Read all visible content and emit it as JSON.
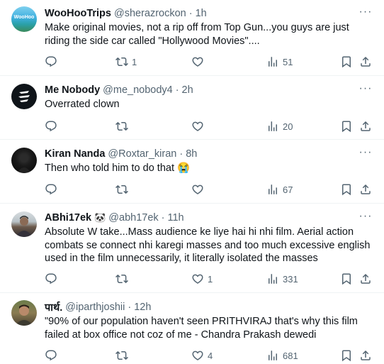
{
  "tweets": [
    {
      "name": "WooHooTrips",
      "handle": "@sherazrockon",
      "separator": "·",
      "time": "1h",
      "avatar_text": "WooHoo",
      "text": "Make original movies, not a rip off from Top Gun...you guys are just riding the side car called \"Hollywood Movies\"....",
      "reply_count": "",
      "retweet_count": "1",
      "like_count": "",
      "view_count": "51"
    },
    {
      "name": "Me Nobody",
      "handle": "@me_nobody4",
      "separator": "·",
      "time": "2h",
      "text": "Overrated clown",
      "reply_count": "",
      "retweet_count": "",
      "like_count": "",
      "view_count": "20"
    },
    {
      "name": "Kiran Nanda",
      "handle": "@Roxtar_kiran",
      "separator": "·",
      "time": "8h",
      "text": "Then who told him to do that 😭",
      "reply_count": "",
      "retweet_count": "",
      "like_count": "",
      "view_count": "67"
    },
    {
      "name": "ABhi17ek",
      "name_emoji": "🐼",
      "handle": "@abh17ek",
      "separator": "·",
      "time": "11h",
      "text": "Absolute W take...Mass audience ke liye hai hi nhi film. Aerial action combats se connect nhi karegi masses and too much excessive english used in the film unnecessarily, it literally isolated the masses",
      "reply_count": "",
      "retweet_count": "",
      "like_count": "1",
      "view_count": "331"
    },
    {
      "name": "पार्थ.",
      "handle": "@iparthjoshii",
      "separator": "·",
      "time": "12h",
      "text": "\"90% of our population haven't seen PRITHVIRAJ that's why this film failed at box office not coz of me - Chandra Prakash dewedi",
      "reply_count": "",
      "retweet_count": "",
      "like_count": "4",
      "view_count": "681"
    }
  ],
  "icons": {
    "reply": "reply-icon",
    "retweet": "retweet-icon",
    "like": "like-icon",
    "views": "views-icon",
    "bookmark": "bookmark-icon",
    "share": "share-icon",
    "more": "more-icon"
  },
  "colors": {
    "text": "#0f1419",
    "muted": "#536471",
    "divider": "#eff3f4"
  }
}
